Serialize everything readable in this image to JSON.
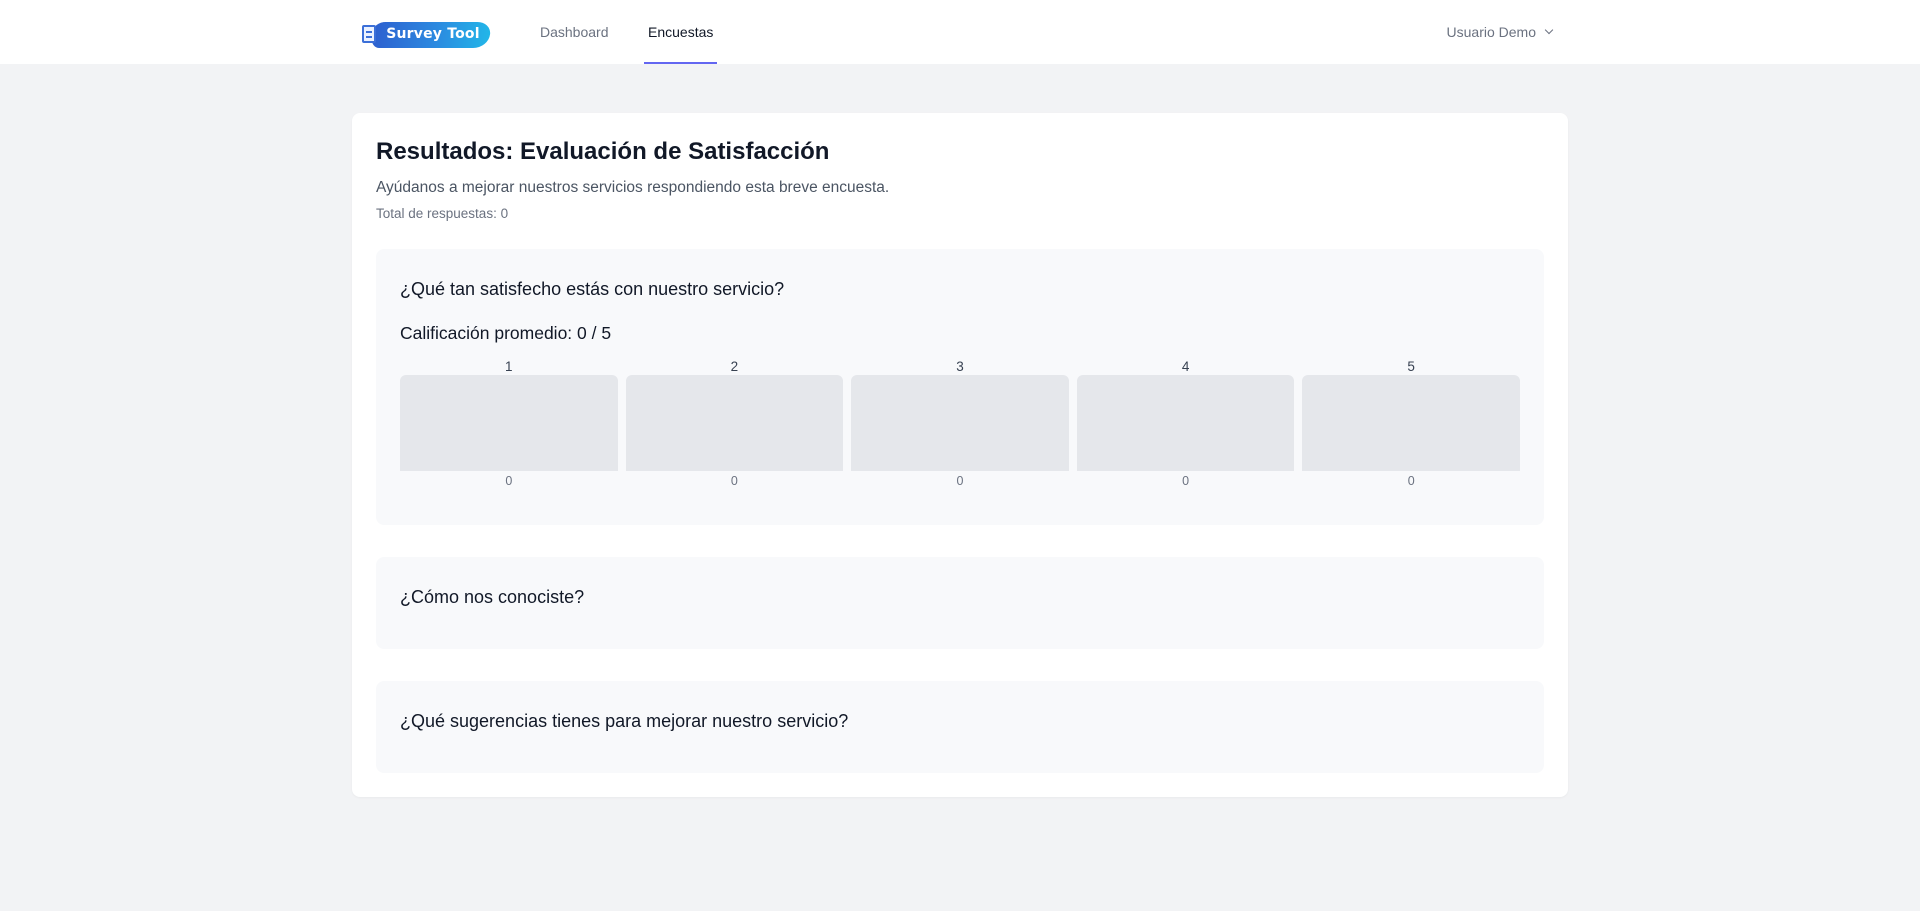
{
  "nav": {
    "brand": "Survey Tool",
    "links": [
      "Dashboard",
      "Encuestas"
    ],
    "active_link": "Encuestas",
    "user": "Usuario Demo"
  },
  "results": {
    "title": "Resultados: Evaluación de Satisfacción",
    "description": "Ayúdanos a mejorar nuestros servicios respondiendo esta breve encuesta.",
    "total_responses": "Total de respuestas: 0",
    "questions": [
      {
        "text": "¿Qué tan satisfecho estás con nuestro servicio?",
        "average": "Calificación promedio: 0 / 5"
      },
      {
        "text": "¿Cómo nos conociste?"
      },
      {
        "text": "¿Qué sugerencias tienes para mejorar nuestro servicio?"
      }
    ]
  },
  "chart_data": {
    "type": "bar",
    "categories": [
      "1",
      "2",
      "3",
      "4",
      "5"
    ],
    "values": [
      0,
      0,
      0,
      0,
      0
    ],
    "value_labels": [
      "0",
      "0",
      "0",
      "0",
      "0"
    ],
    "title": "",
    "xlabel": "",
    "ylabel": ""
  },
  "colors": {
    "accent": "#6366f1",
    "bar_track": "#e5e7eb",
    "page_bg": "#f2f3f5",
    "question_bg": "#f8f9fb"
  },
  "icons": [
    "document-icon",
    "chevron-down-icon"
  ]
}
